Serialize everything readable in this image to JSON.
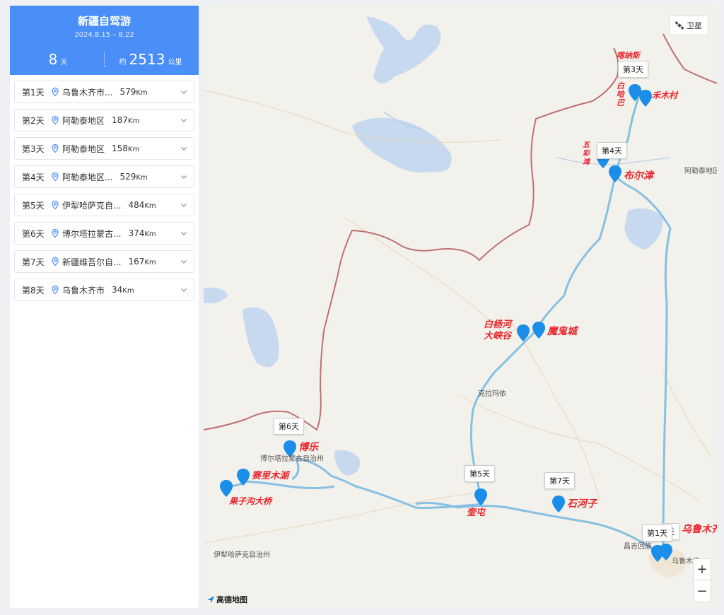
{
  "trip": {
    "title": "新疆自驾游",
    "dates": "2024.8.15 – 8.22",
    "days_num": "8",
    "days_unit": "天",
    "dist_prefix": "约",
    "dist_num": "2513",
    "dist_unit": "公里"
  },
  "days": [
    {
      "day": "第1天",
      "place": "乌鲁木齐市...",
      "dist": "579",
      "unit": "Km"
    },
    {
      "day": "第2天",
      "place": "阿勒泰地区",
      "dist": "187",
      "unit": "Km"
    },
    {
      "day": "第3天",
      "place": "阿勒泰地区",
      "dist": "158",
      "unit": "Km"
    },
    {
      "day": "第4天",
      "place": "阿勒泰地区...",
      "dist": "529",
      "unit": "Km"
    },
    {
      "day": "第5天",
      "place": "伊犁哈萨克自...",
      "dist": "484",
      "unit": "Km"
    },
    {
      "day": "第6天",
      "place": "博尔塔拉蒙古...",
      "dist": "374",
      "unit": "Km"
    },
    {
      "day": "第7天",
      "place": "新疆维吾尔自...",
      "dist": "167",
      "unit": "Km"
    },
    {
      "day": "第8天",
      "place": "乌鲁木齐市",
      "dist": "34",
      "unit": "Km"
    }
  ],
  "map": {
    "satellite_label": "卫星",
    "zoom_in": "+",
    "zoom_out": "−",
    "logo": "高德地图",
    "day_tags": {
      "d1": "第1天",
      "d3": "第3天",
      "d4": "第4天",
      "d5": "第5天",
      "d6": "第6天",
      "d7": "第7天",
      "d8_partial": "天"
    },
    "places": {
      "altay": "阿勒泰地区",
      "karamay": "克拉玛依",
      "bortala": "博尔塔拉蒙古自治州",
      "ili": "伊犁哈萨克自治州",
      "changji": "昌吉回族",
      "urumqi": "乌鲁木齐"
    },
    "handwriting": {
      "kanas": "喀纳斯",
      "hemu": "禾木村",
      "baihaba": "白哈巴",
      "wucaitan": "五彩滩",
      "burqin": "布尔津",
      "baiyanghe": "白杨河大峡谷",
      "ghostcity": "魔鬼城",
      "bole": "博乐",
      "sayram": "赛里木湖",
      "guozigou": "果子沟大桥",
      "kuitun": "奎屯",
      "shihezi": "石河子",
      "urumqi": "乌鲁木齐"
    }
  },
  "colors": {
    "header": "#4a8ef7",
    "route": "#86c0e2",
    "pin": "#1a8ee8",
    "border": "#c07070",
    "water": "#c6d9ef",
    "handwriting": "#e8262d"
  }
}
